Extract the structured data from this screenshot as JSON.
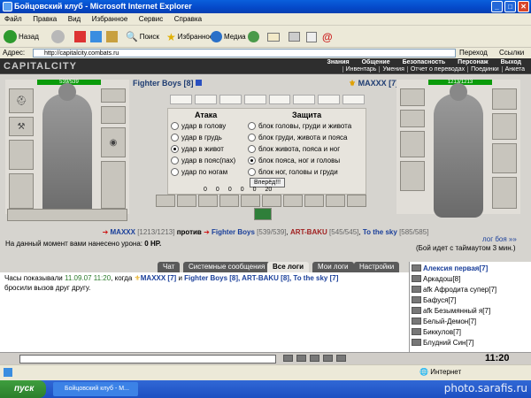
{
  "window": {
    "title": "Бойцовский клуб - Microsoft Internet Explorer"
  },
  "menu": [
    "Файл",
    "Правка",
    "Вид",
    "Избранное",
    "Сервис",
    "Справка"
  ],
  "toolbar": {
    "back": "Назад",
    "search": "Поиск",
    "favorites": "Избранное",
    "media": "Медиа"
  },
  "address": {
    "label": "Адрес:",
    "value": "http://capitalcity.combats.ru",
    "go": "Переход",
    "links": "Ссылки"
  },
  "game": {
    "logo": "CAPITALCITY",
    "nav_top": [
      "Знания",
      "Общение",
      "Безопасность",
      "Персонаж",
      "Выход"
    ],
    "nav_bottom": [
      "Инвентарь",
      "Умения",
      "Отчет о переводах",
      "Поединки",
      "Анкета"
    ],
    "left_fighter": {
      "name": "Fighter Boys [8]",
      "hp": "539/539",
      "hp_fraction": 1.0
    },
    "right_fighter": {
      "name": "MAXXX [7]",
      "hp": "1213/1213",
      "hp_fraction": 1.0
    },
    "attack": {
      "title": "Атака",
      "options": [
        "удар в голову",
        "удар в грудь",
        "удар в живот",
        "удар в пояс(пах)",
        "удар по ногам"
      ],
      "selected": 2
    },
    "defense": {
      "title": "Защита",
      "options": [
        "блок головы, груди и живота",
        "блок груди, живота и пояса",
        "блок живота, пояса и ног",
        "блок пояса, ног и головы",
        "блок ног, головы и груди"
      ],
      "selected": 3
    },
    "go_button": "Вперёд!!!",
    "counters": [
      "0",
      "0",
      "0",
      "0",
      "0",
      "20"
    ],
    "battle_line": {
      "left": "MAXXX",
      "left_hp": "[1213/1213]",
      "vs": "против",
      "team": [
        {
          "name": "Fighter Boys",
          "hp": "[539/539]"
        },
        {
          "name": "ART-BAKU",
          "hp": "[545/545]"
        },
        {
          "name": "To the sky",
          "hp": "[585/585]"
        }
      ]
    },
    "damage_text": "На данный момент вами нанесено урона:",
    "damage_value": "0 HP.",
    "battle_log_link": "лог боя »»",
    "timeout_text": "(Бой идет с таймаутом 3 мин.)"
  },
  "chat": {
    "tabs": [
      "Чат",
      "Системные сообщения",
      "Все логи",
      "Мои логи",
      "Настройки"
    ],
    "active_tab": 2,
    "message": {
      "prefix": "Часы показывали",
      "time": "11.09.07 11:20",
      "mid": ", когда",
      "actor": "MAXXX [7]",
      "and": "и",
      "targets": "Fighter Boys [8], ART-BAKU [8], To the sky [7]",
      "suffix": "бросили вызов друг другу."
    }
  },
  "users": [
    "Алексия первая[7]",
    "Аркадош[8]",
    "afk Афродита супер[7]",
    "Бафуся[7]",
    "afk Безымянный я[7]",
    "Белый-Демон[7]",
    "Биккулов[7]",
    "Блудний Син[7]"
  ],
  "clock": "11:20",
  "status": {
    "zone": "Интернет"
  },
  "taskbar": {
    "start": "пуск",
    "task": "Бойцовский клуб - M...",
    "watermark": "photo.sarafis.ru"
  }
}
